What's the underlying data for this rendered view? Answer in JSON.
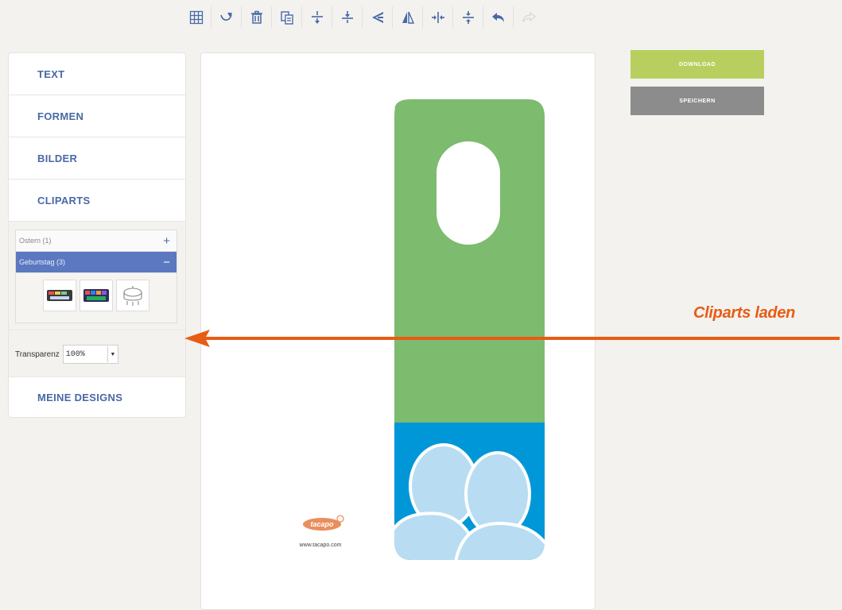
{
  "toolbar": {
    "buttons": [
      {
        "icon": "grid-icon"
      },
      {
        "icon": "eraser-icon"
      },
      {
        "icon": "trash-icon"
      },
      {
        "icon": "copy-icon"
      },
      {
        "icon": "align-top-icon"
      },
      {
        "icon": "align-middle-icon"
      },
      {
        "icon": "send-backward-icon"
      },
      {
        "icon": "flip-horizontal-icon"
      },
      {
        "icon": "center-horizontal-icon"
      },
      {
        "icon": "center-vertical-icon"
      },
      {
        "icon": "undo-icon"
      },
      {
        "icon": "redo-icon"
      }
    ]
  },
  "sidebar": {
    "text": "TEXT",
    "formen": "FORMEN",
    "bilder": "BILDER",
    "cliparts": "CLIPARTS",
    "categories": [
      {
        "label": "Ostern (1)",
        "sign": "+"
      },
      {
        "label": "Geburtstag (3)",
        "sign": "−"
      }
    ],
    "transparency_label": "Transparenz",
    "transparency_value": "100%",
    "meine_designs": "MEINE DESIGNS"
  },
  "canvas": {
    "logo_text": "tacapo",
    "url": "www.tacapo.com"
  },
  "actions": {
    "download": "DOWNLOAD",
    "save": "SPEICHERN"
  },
  "annotation": {
    "text": "Cliparts laden"
  },
  "colors": {
    "accent": "#4a68a6",
    "category_active": "#5b78c0",
    "download": "#b8cf60",
    "save": "#8c8c8c",
    "hanger_green": "#7dbb6e",
    "hanger_blue": "#0097d8",
    "annotation": "#e85c14"
  }
}
